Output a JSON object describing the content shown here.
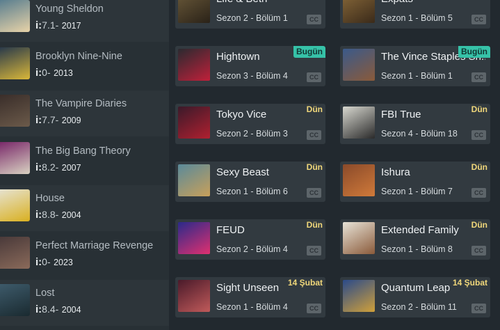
{
  "sidebar": {
    "rating_prefix": "i:",
    "items": [
      {
        "title": "Young Sheldon",
        "rating": "7.1-",
        "year": "2017",
        "thumb": [
          "#5a7e8f",
          "#e8d3a8"
        ]
      },
      {
        "title": "Brooklyn Nine-Nine",
        "rating": "0-",
        "year": "2013",
        "thumb": [
          "#2a3a4a",
          "#d9b73a"
        ]
      },
      {
        "title": "The Vampire Diaries",
        "rating": "7.7-",
        "year": "2009",
        "thumb": [
          "#3a2e2a",
          "#6b5a4a"
        ]
      },
      {
        "title": "The Big Bang Theory",
        "rating": "8.2-",
        "year": "2007",
        "thumb": [
          "#7a2a6a",
          "#d9d2c2"
        ]
      },
      {
        "title": "House",
        "rating": "8.8-",
        "year": "2004",
        "thumb": [
          "#e6e2cf",
          "#d9b020"
        ]
      },
      {
        "title": "Perfect Marriage Revenge",
        "rating": "0-",
        "year": "2023",
        "thumb": [
          "#4a3a3a",
          "#8a6a5a"
        ]
      },
      {
        "title": "Lost",
        "rating": "8.4-",
        "year": "2004",
        "thumb": [
          "#3d5a6a",
          "#1a2a30"
        ]
      }
    ]
  },
  "episodes": {
    "cc_label": "CC",
    "cards": [
      {
        "title": "Life & Beth",
        "episode": "Sezon 2 - Bölüm 1",
        "badge": "",
        "badge_type": "",
        "thumb": [
          "#6b5a3a",
          "#2a2218"
        ]
      },
      {
        "title": "Expats",
        "episode": "Sezon 1 - Bölüm 5",
        "badge": "",
        "badge_type": "",
        "thumb": [
          "#8a6a3a",
          "#3a2a1a"
        ]
      },
      {
        "title": "Hightown",
        "episode": "Sezon 3 - Bölüm 4",
        "badge": "Bugün",
        "badge_type": "today",
        "thumb": [
          "#2a2a30",
          "#c0203a"
        ]
      },
      {
        "title": "The Vince Staples Sh...",
        "episode": "Sezon 1 - Bölüm 1",
        "badge": "Bugün",
        "badge_type": "today",
        "thumb": [
          "#3a5a8a",
          "#8a5a3a"
        ]
      },
      {
        "title": "Tokyo Vice",
        "episode": "Sezon 2 - Bölüm 3",
        "badge": "Dün",
        "badge_type": "yesterday",
        "thumb": [
          "#3a1a2a",
          "#b02030"
        ]
      },
      {
        "title": "FBI True",
        "episode": "Sezon 4 - Bölüm 18",
        "badge": "Dün",
        "badge_type": "yesterday",
        "thumb": [
          "#d8d8d0",
          "#2a2a2a"
        ]
      },
      {
        "title": "Sexy Beast",
        "episode": "Sezon 1 - Bölüm 6",
        "badge": "Dün",
        "badge_type": "yesterday",
        "thumb": [
          "#5a8a9a",
          "#c8a05a"
        ]
      },
      {
        "title": "Ishura",
        "episode": "Sezon 1 - Bölüm 7",
        "badge": "Dün",
        "badge_type": "yesterday",
        "thumb": [
          "#8a4a2a",
          "#d07a3a"
        ]
      },
      {
        "title": "FEUD",
        "episode": "Sezon 2 - Bölüm 4",
        "badge": "Dün",
        "badge_type": "yesterday",
        "thumb": [
          "#2a2a8a",
          "#e03070"
        ]
      },
      {
        "title": "Extended Family",
        "episode": "Sezon 1 - Bölüm 8",
        "badge": "Dün",
        "badge_type": "yesterday",
        "thumb": [
          "#e8e4d8",
          "#8a5a3a"
        ]
      },
      {
        "title": "Sight Unseen",
        "episode": "Sezon 1 - Bölüm 4",
        "badge": "14 Şubat",
        "badge_type": "date",
        "thumb": [
          "#4a1a2a",
          "#c05a5a"
        ]
      },
      {
        "title": "Quantum Leap",
        "episode": "Sezon 2 - Bölüm 11",
        "badge": "14 Şubat",
        "badge_type": "date",
        "thumb": [
          "#2a4a8a",
          "#d0a03a"
        ]
      }
    ]
  }
}
